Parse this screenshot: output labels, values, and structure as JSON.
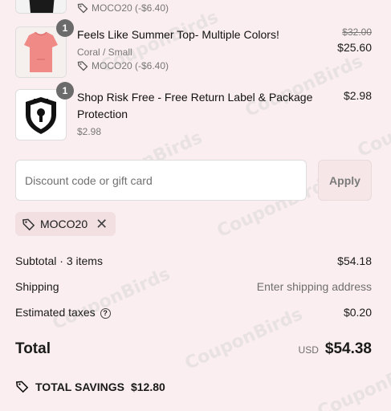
{
  "items": [
    {
      "discount": "MOCO20 (-$6.40)"
    },
    {
      "quantity": "1",
      "title": "Feels Like Summer Top- Multiple Colors!",
      "variant": "Coral / Small",
      "discount": "MOCO20 (-$6.40)",
      "original_price": "$32.00",
      "price": "$25.60"
    },
    {
      "quantity": "1",
      "title": "Shop Risk Free - Free Return Label & Package Protection",
      "variant": "$2.98",
      "price": "$2.98"
    }
  ],
  "discount": {
    "placeholder": "Discount code or gift card",
    "apply_label": "Apply"
  },
  "applied_code": {
    "code": "MOCO20",
    "remove": "✕"
  },
  "summary": {
    "subtotal_label": "Subtotal · 3 items",
    "subtotal_value": "$54.18",
    "shipping_label": "Shipping",
    "shipping_value": "Enter shipping address",
    "taxes_label": "Estimated taxes",
    "taxes_value": "$0.20",
    "total_label": "Total",
    "currency": "USD",
    "total_value": "$54.38",
    "savings_label": "TOTAL SAVINGS",
    "savings_value": "$12.80"
  },
  "icons": {
    "tag": "tag-icon",
    "help": "question-circle-icon",
    "close": "close-icon"
  },
  "colors": {
    "background": "#fbeef0",
    "chip": "#f2dfe2",
    "qty_badge": "#6b6b6b",
    "shirt": "#f08a86"
  }
}
